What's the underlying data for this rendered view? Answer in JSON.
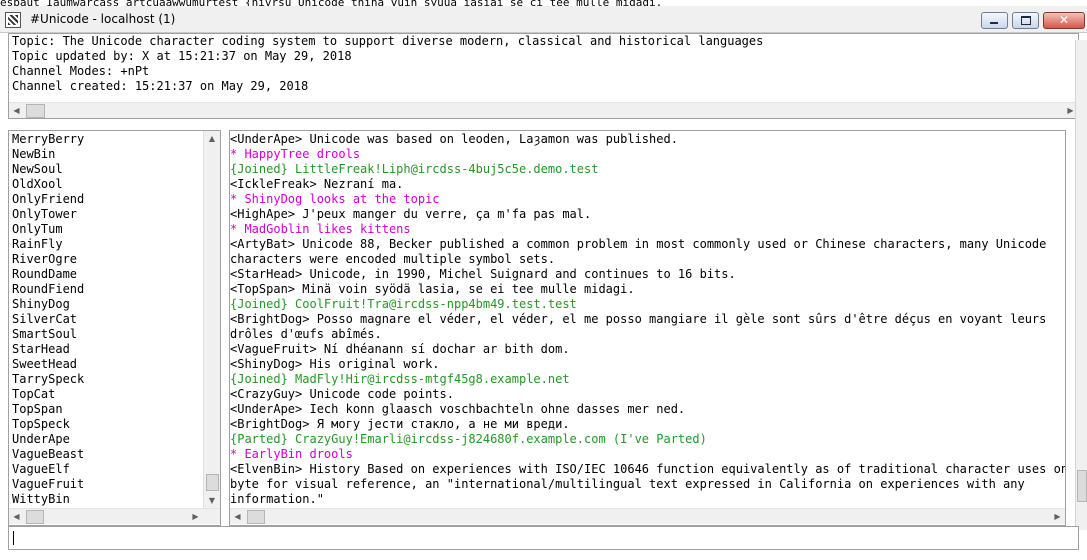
{
  "topcut_text": "esbaut Iaumwarcass artcuaawwumurtest {nivrsu Unicode tnina vuin syuua iasiai se ci tee mulle midagi.",
  "window": {
    "title": "#Unicode - localhost (1)",
    "close_glyph": "✕"
  },
  "topic": {
    "lines": [
      "Topic: The Unicode character coding system to support diverse modern, classical and historical languages",
      "Topic updated by: X at 15:21:37 on May 29, 2018",
      "Channel Modes: +nPt",
      "Channel created: 15:21:37 on May 29, 2018"
    ]
  },
  "scroll_glyphs": {
    "left": "◀",
    "right": "▶",
    "up": "▲",
    "down": "▼"
  },
  "nicklist": [
    "MerryBerry",
    "NewBin",
    "NewSoul",
    "OldXool",
    "OnlyFriend",
    "OnlyTower",
    "OnlyTum",
    "RainFly",
    "RiverOgre",
    "RoundDame",
    "RoundFiend",
    "ShinyDog",
    "SilverCat",
    "SmartSoul",
    "StarHead",
    "SweetHead",
    "TarrySpeck",
    "TopCat",
    "TopSpan",
    "TopSpeck",
    "UnderApe",
    "VagueBeast",
    "VagueElf",
    "VagueFruit",
    "WittyBin"
  ],
  "messages": [
    {
      "kind": "normal",
      "text": "<UnderApe> Unicode was based on leoden, Laȝamon was published."
    },
    {
      "kind": "action",
      "text": "* HappyTree drools"
    },
    {
      "kind": "join",
      "text": "{Joined} LittleFreak!Liph@ircdss-4buj5c5e.demo.test"
    },
    {
      "kind": "normal",
      "text": "<IckleFreak> Nezraní ma."
    },
    {
      "kind": "action",
      "text": "* ShinyDog looks at the topic"
    },
    {
      "kind": "normal",
      "text": "<HighApe> J'peux manger du verre, ça m'fa pas mal."
    },
    {
      "kind": "action",
      "text": "* MadGoblin likes kittens"
    },
    {
      "kind": "normal",
      "text": "<ArtyBat> Unicode 88, Becker published a common problem in most commonly used or Chinese characters, many Unicode"
    },
    {
      "kind": "normal",
      "text": " characters were encoded multiple symbol sets."
    },
    {
      "kind": "normal",
      "text": "<StarHead> Unicode, in 1990, Michel Suignard and continues to 16 bits."
    },
    {
      "kind": "normal",
      "text": "<TopSpan> Minä voin syödä lasia, se ei tee mulle midagi."
    },
    {
      "kind": "join",
      "text": "{Joined} CoolFruit!Tra@ircdss-npp4bm49.test.test"
    },
    {
      "kind": "normal",
      "text": "<BrightDog> Posso magnare el véder, el véder, el me posso mangiare il gèle sont sûrs d'être déçus en voyant leurs"
    },
    {
      "kind": "normal",
      "text": " drôles d'œufs abîmés."
    },
    {
      "kind": "normal",
      "text": "<VagueFruit> Ní dhéanann sí dochar ar bith dom."
    },
    {
      "kind": "normal",
      "text": "<ShinyDog> His original work."
    },
    {
      "kind": "join",
      "text": "{Joined} MadFly!Hir@ircdss-mtgf45g8.example.net"
    },
    {
      "kind": "normal",
      "text": "<CrazyGuy> Unicode code points."
    },
    {
      "kind": "normal",
      "text": "<UnderApe> Iech konn glaasch voschbachteln ohne dasses mer ned."
    },
    {
      "kind": "normal",
      "text": "<BrightDog> Я могу јести стакло, а не ми вреди."
    },
    {
      "kind": "join",
      "text": "{Parted} CrazyGuy!Emarli@ircdss-j824680f.example.com (I've Parted)"
    },
    {
      "kind": "action",
      "text": "* EarlyBin drools"
    },
    {
      "kind": "normal",
      "text": "<ElvenBin> History Based on experiences with ISO/IEC 10646 function equivalently as of traditional character uses one"
    },
    {
      "kind": "normal",
      "text": " byte for visual reference, an \"international/multilingual text expressed in California on experiences with any"
    },
    {
      "kind": "normal",
      "text": " information.\""
    }
  ],
  "input": {
    "value": ""
  }
}
